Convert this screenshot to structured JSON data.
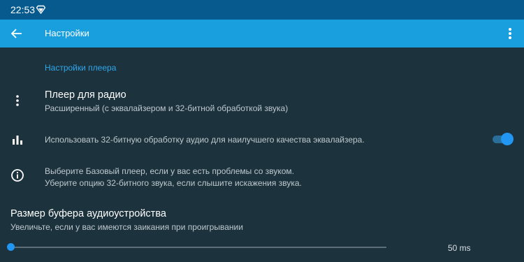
{
  "status_bar": {
    "time": "22:53"
  },
  "app_bar": {
    "title": "Настройки"
  },
  "section": {
    "title": "Настройки плеера"
  },
  "player_for_radio": {
    "title": "Плеер для радио",
    "summary": "Расширенный (с эквалайзером и 32-битной обработкой звука)"
  },
  "use_32bit": {
    "summary": "Использовать 32-битную обработку аудио для наилучшего качества эквалайзера.",
    "enabled": true
  },
  "info": {
    "line1": "Выберите Базовый плеер, если у вас есть проблемы со звуком.",
    "line2": "Уберите опцию 32-битного звука, если слышите искажения звука."
  },
  "buffer_size": {
    "title": "Размер буфера аудиоустройства",
    "summary": "Увеличьте, если у вас имеются заикания при проигрывании",
    "value_label": "50 ms",
    "slider_fraction": 0.0
  },
  "colors": {
    "status_bar": "#075a8e",
    "app_bar": "#199fde",
    "background": "#1c323d",
    "accent": "#2196f3"
  }
}
